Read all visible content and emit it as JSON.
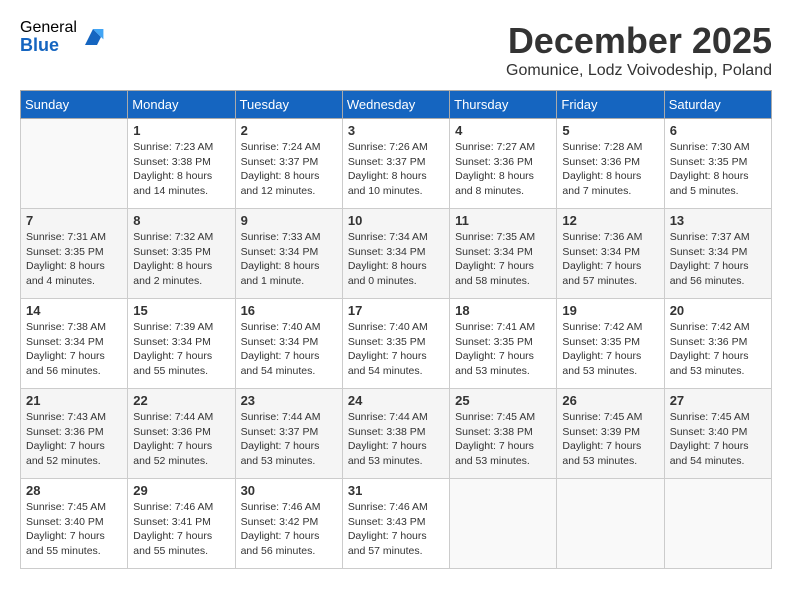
{
  "logo": {
    "general": "General",
    "blue": "Blue"
  },
  "header": {
    "month": "December 2025",
    "location": "Gomunice, Lodz Voivodeship, Poland"
  },
  "weekdays": [
    "Sunday",
    "Monday",
    "Tuesday",
    "Wednesday",
    "Thursday",
    "Friday",
    "Saturday"
  ],
  "weeks": [
    [
      {
        "day": "",
        "sunrise": "",
        "sunset": "",
        "daylight": ""
      },
      {
        "day": "1",
        "sunrise": "Sunrise: 7:23 AM",
        "sunset": "Sunset: 3:38 PM",
        "daylight": "Daylight: 8 hours and 14 minutes."
      },
      {
        "day": "2",
        "sunrise": "Sunrise: 7:24 AM",
        "sunset": "Sunset: 3:37 PM",
        "daylight": "Daylight: 8 hours and 12 minutes."
      },
      {
        "day": "3",
        "sunrise": "Sunrise: 7:26 AM",
        "sunset": "Sunset: 3:37 PM",
        "daylight": "Daylight: 8 hours and 10 minutes."
      },
      {
        "day": "4",
        "sunrise": "Sunrise: 7:27 AM",
        "sunset": "Sunset: 3:36 PM",
        "daylight": "Daylight: 8 hours and 8 minutes."
      },
      {
        "day": "5",
        "sunrise": "Sunrise: 7:28 AM",
        "sunset": "Sunset: 3:36 PM",
        "daylight": "Daylight: 8 hours and 7 minutes."
      },
      {
        "day": "6",
        "sunrise": "Sunrise: 7:30 AM",
        "sunset": "Sunset: 3:35 PM",
        "daylight": "Daylight: 8 hours and 5 minutes."
      }
    ],
    [
      {
        "day": "7",
        "sunrise": "Sunrise: 7:31 AM",
        "sunset": "Sunset: 3:35 PM",
        "daylight": "Daylight: 8 hours and 4 minutes."
      },
      {
        "day": "8",
        "sunrise": "Sunrise: 7:32 AM",
        "sunset": "Sunset: 3:35 PM",
        "daylight": "Daylight: 8 hours and 2 minutes."
      },
      {
        "day": "9",
        "sunrise": "Sunrise: 7:33 AM",
        "sunset": "Sunset: 3:34 PM",
        "daylight": "Daylight: 8 hours and 1 minute."
      },
      {
        "day": "10",
        "sunrise": "Sunrise: 7:34 AM",
        "sunset": "Sunset: 3:34 PM",
        "daylight": "Daylight: 8 hours and 0 minutes."
      },
      {
        "day": "11",
        "sunrise": "Sunrise: 7:35 AM",
        "sunset": "Sunset: 3:34 PM",
        "daylight": "Daylight: 7 hours and 58 minutes."
      },
      {
        "day": "12",
        "sunrise": "Sunrise: 7:36 AM",
        "sunset": "Sunset: 3:34 PM",
        "daylight": "Daylight: 7 hours and 57 minutes."
      },
      {
        "day": "13",
        "sunrise": "Sunrise: 7:37 AM",
        "sunset": "Sunset: 3:34 PM",
        "daylight": "Daylight: 7 hours and 56 minutes."
      }
    ],
    [
      {
        "day": "14",
        "sunrise": "Sunrise: 7:38 AM",
        "sunset": "Sunset: 3:34 PM",
        "daylight": "Daylight: 7 hours and 56 minutes."
      },
      {
        "day": "15",
        "sunrise": "Sunrise: 7:39 AM",
        "sunset": "Sunset: 3:34 PM",
        "daylight": "Daylight: 7 hours and 55 minutes."
      },
      {
        "day": "16",
        "sunrise": "Sunrise: 7:40 AM",
        "sunset": "Sunset: 3:34 PM",
        "daylight": "Daylight: 7 hours and 54 minutes."
      },
      {
        "day": "17",
        "sunrise": "Sunrise: 7:40 AM",
        "sunset": "Sunset: 3:35 PM",
        "daylight": "Daylight: 7 hours and 54 minutes."
      },
      {
        "day": "18",
        "sunrise": "Sunrise: 7:41 AM",
        "sunset": "Sunset: 3:35 PM",
        "daylight": "Daylight: 7 hours and 53 minutes."
      },
      {
        "day": "19",
        "sunrise": "Sunrise: 7:42 AM",
        "sunset": "Sunset: 3:35 PM",
        "daylight": "Daylight: 7 hours and 53 minutes."
      },
      {
        "day": "20",
        "sunrise": "Sunrise: 7:42 AM",
        "sunset": "Sunset: 3:36 PM",
        "daylight": "Daylight: 7 hours and 53 minutes."
      }
    ],
    [
      {
        "day": "21",
        "sunrise": "Sunrise: 7:43 AM",
        "sunset": "Sunset: 3:36 PM",
        "daylight": "Daylight: 7 hours and 52 minutes."
      },
      {
        "day": "22",
        "sunrise": "Sunrise: 7:44 AM",
        "sunset": "Sunset: 3:36 PM",
        "daylight": "Daylight: 7 hours and 52 minutes."
      },
      {
        "day": "23",
        "sunrise": "Sunrise: 7:44 AM",
        "sunset": "Sunset: 3:37 PM",
        "daylight": "Daylight: 7 hours and 53 minutes."
      },
      {
        "day": "24",
        "sunrise": "Sunrise: 7:44 AM",
        "sunset": "Sunset: 3:38 PM",
        "daylight": "Daylight: 7 hours and 53 minutes."
      },
      {
        "day": "25",
        "sunrise": "Sunrise: 7:45 AM",
        "sunset": "Sunset: 3:38 PM",
        "daylight": "Daylight: 7 hours and 53 minutes."
      },
      {
        "day": "26",
        "sunrise": "Sunrise: 7:45 AM",
        "sunset": "Sunset: 3:39 PM",
        "daylight": "Daylight: 7 hours and 53 minutes."
      },
      {
        "day": "27",
        "sunrise": "Sunrise: 7:45 AM",
        "sunset": "Sunset: 3:40 PM",
        "daylight": "Daylight: 7 hours and 54 minutes."
      }
    ],
    [
      {
        "day": "28",
        "sunrise": "Sunrise: 7:45 AM",
        "sunset": "Sunset: 3:40 PM",
        "daylight": "Daylight: 7 hours and 55 minutes."
      },
      {
        "day": "29",
        "sunrise": "Sunrise: 7:46 AM",
        "sunset": "Sunset: 3:41 PM",
        "daylight": "Daylight: 7 hours and 55 minutes."
      },
      {
        "day": "30",
        "sunrise": "Sunrise: 7:46 AM",
        "sunset": "Sunset: 3:42 PM",
        "daylight": "Daylight: 7 hours and 56 minutes."
      },
      {
        "day": "31",
        "sunrise": "Sunrise: 7:46 AM",
        "sunset": "Sunset: 3:43 PM",
        "daylight": "Daylight: 7 hours and 57 minutes."
      },
      {
        "day": "",
        "sunrise": "",
        "sunset": "",
        "daylight": ""
      },
      {
        "day": "",
        "sunrise": "",
        "sunset": "",
        "daylight": ""
      },
      {
        "day": "",
        "sunrise": "",
        "sunset": "",
        "daylight": ""
      }
    ]
  ]
}
